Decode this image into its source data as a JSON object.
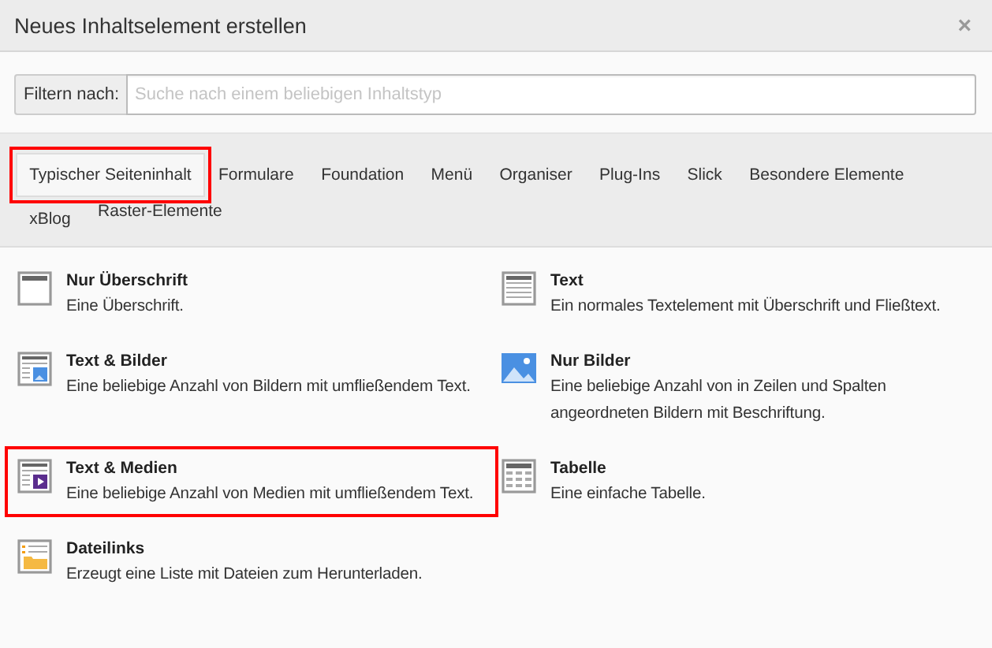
{
  "window": {
    "title": "Neues Inhaltselement erstellen",
    "close": "×"
  },
  "filter": {
    "label": "Filtern nach:",
    "placeholder": "Suche nach einem beliebigen Inhaltstyp"
  },
  "tabs": [
    {
      "label": "Typischer Seiteninhalt",
      "selected": true,
      "highlighted": true
    },
    {
      "label": "Formulare",
      "selected": false,
      "highlighted": false
    },
    {
      "label": "Foundation",
      "selected": false,
      "highlighted": false
    },
    {
      "label": "Menü",
      "selected": false,
      "highlighted": false
    },
    {
      "label": "Organiser",
      "selected": false,
      "highlighted": false
    },
    {
      "label": "Plug-Ins",
      "selected": false,
      "highlighted": false
    },
    {
      "label": "Slick",
      "selected": false,
      "highlighted": false
    },
    {
      "label": "Besondere Elemente",
      "selected": false,
      "highlighted": false
    },
    {
      "label": "xBlog",
      "selected": false,
      "highlighted": false
    },
    {
      "label": "Raster-Elemente",
      "selected": false,
      "highlighted": false
    }
  ],
  "elements": [
    {
      "kind": "header",
      "title": "Nur Überschrift",
      "description": "Eine Überschrift.",
      "highlighted": false
    },
    {
      "kind": "text",
      "title": "Text",
      "description": "Ein normales Textelement mit Überschrift und Fließtext.",
      "highlighted": false
    },
    {
      "kind": "textpic",
      "title": "Text & Bilder",
      "description": "Eine beliebige Anzahl von Bildern mit umfließendem Text.",
      "highlighted": false
    },
    {
      "kind": "image",
      "title": "Nur Bilder",
      "description": "Eine beliebige Anzahl von in Zeilen und Spalten angeordneten Bildern mit Beschriftung.",
      "highlighted": false
    },
    {
      "kind": "textmedia",
      "title": "Text & Medien",
      "description": "Eine beliebige Anzahl von Medien mit umfließendem Text.",
      "highlighted": true
    },
    {
      "kind": "table",
      "title": "Tabelle",
      "description": "Eine einfache Tabelle.",
      "highlighted": false
    },
    {
      "kind": "uploads",
      "title": "Dateilinks",
      "description": "Erzeugt eine Liste mit Dateien zum Herunterladen.",
      "highlighted": false
    }
  ]
}
